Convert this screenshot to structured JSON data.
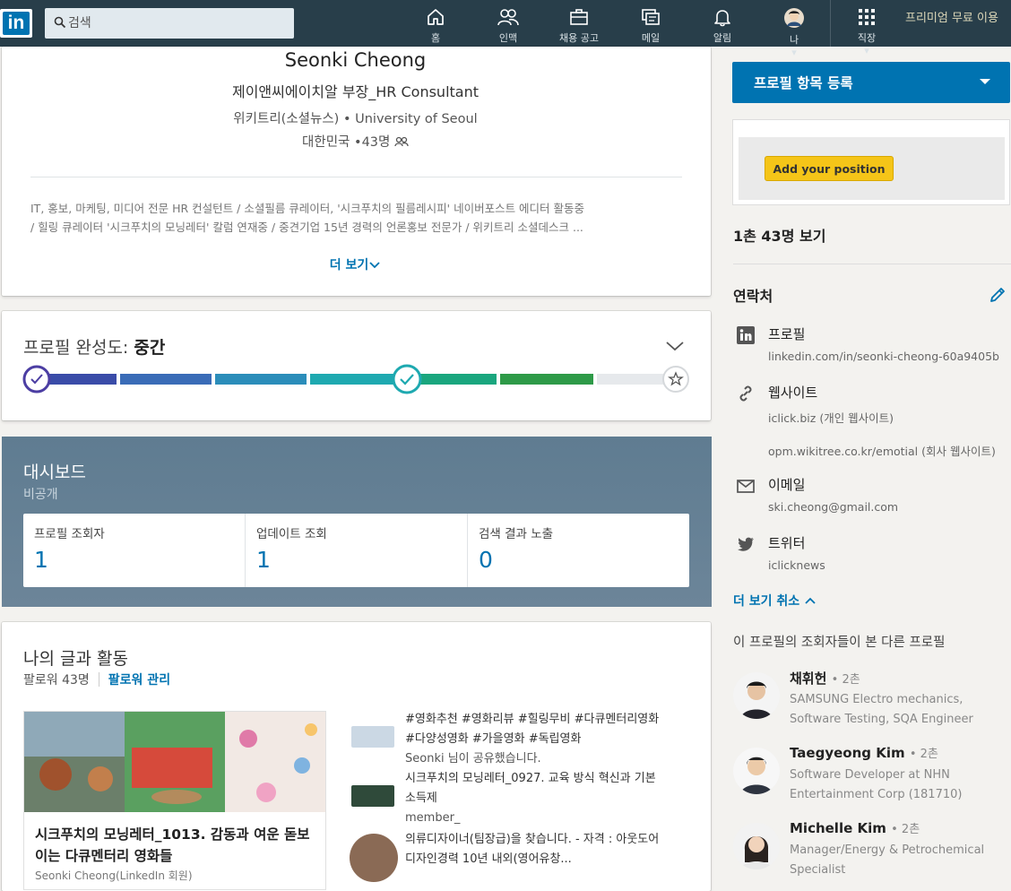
{
  "nav": {
    "logo": "in",
    "search_placeholder": "검색",
    "items": [
      {
        "label": "홈",
        "icon": "home-icon"
      },
      {
        "label": "인맥",
        "icon": "network-icon"
      },
      {
        "label": "채용 공고",
        "icon": "jobs-icon"
      },
      {
        "label": "메일",
        "icon": "messaging-icon"
      },
      {
        "label": "알림",
        "icon": "bell-icon"
      },
      {
        "label": "나",
        "icon": "avatar"
      },
      {
        "label": "직장",
        "icon": "grid-icon"
      }
    ],
    "premium": "프리미엄 무료 이용"
  },
  "profile": {
    "name": "Seonki Cheong",
    "headline": "제이앤씨에이치알 부장_HR Consultant",
    "company": "위키트리(소셜뉴스)",
    "school": "University of Seoul",
    "location": "대한민국",
    "connections": "43명",
    "summary_lines": [
      "IT, 홍보, 마케팅, 미디어 전문 HR 컨설턴트 / 소셜필름 큐레이터, '시크푸치의 필름레시피' 네이버포스트 에디터 활동중",
      "/ 힐링 큐레이터 '시크푸치의 모닝레터' 칼럼 연재중 / 중견기업 15년 경력의 언론홍보 전문가 / 위키트리 소셜데스크 ..."
    ],
    "more": "더 보기"
  },
  "strength": {
    "label": "프로필 완성도:",
    "level": "중간",
    "progress_percent": 55
  },
  "dashboard": {
    "title": "대시보드",
    "subtitle": "비공개",
    "stats": [
      {
        "label": "프로필 조회자",
        "value": "1"
      },
      {
        "label": "업데이트 조회",
        "value": "1"
      },
      {
        "label": "검색 결과 노출",
        "value": "0"
      }
    ]
  },
  "activity": {
    "title": "나의 글과 활동",
    "followers": "팔로워 43명",
    "manage": "팔로워 관리",
    "article": {
      "title": "시크푸치의 모닝레터_1013. 감동과 여운 돋보이는 다큐멘터리 영화들",
      "author": "Seonki Cheong(LinkedIn 회원)"
    },
    "feed": [
      {
        "text": "#영화추천 #영화리뷰 #힐링무비 #다큐멘터리영화 #다양성영화 #가을영화 #독립영화",
        "by": "Seonki 님이 공유했습니다."
      },
      {
        "text": "시크푸치의 모닝레터_0927. 교육 방식 혁신과 기본소득제",
        "by": "member_"
      },
      {
        "text": "의류디자이너(팀장급)을 찾습니다. - 자격 : 아웃도어 디자인경력 10년 내외(영어유창...",
        "by": ""
      }
    ]
  },
  "sidebar": {
    "cta": "프로필 항목 등록",
    "ad_button": "Add your position",
    "connections_link": "1촌 43명 보기",
    "contact_title": "연락처",
    "contacts": [
      {
        "label": "프로필",
        "icon": "linkedin-icon",
        "values": [
          "linkedin.com/in/seonki-cheong-60a9405b"
        ]
      },
      {
        "label": "웹사이트",
        "icon": "link-icon",
        "values": [
          "iclick.biz (개인 웹사이트)",
          "opm.wikitree.co.kr/emotial (회사 웹사이트)"
        ]
      },
      {
        "label": "이메일",
        "icon": "mail-icon",
        "values": [
          "ski.cheong@gmail.com"
        ]
      },
      {
        "label": "트위터",
        "icon": "twitter-icon",
        "values": [
          "iclicknews"
        ]
      }
    ],
    "less": "더 보기 취소",
    "also_viewed": "이 프로필의 조회자들이 본 다른 프로필",
    "people": [
      {
        "name": "채휘헌",
        "degree": "• 2촌",
        "desc": "SAMSUNG Electro mechanics, Software Testing, SQA Engineer"
      },
      {
        "name": "Taegyeong Kim",
        "degree": "• 2촌",
        "desc": "Software Developer at NHN Entertainment Corp (181710)"
      },
      {
        "name": "Michelle Kim",
        "degree": "• 2촌",
        "desc": "Manager/Energy & Petrochemical Specialist"
      }
    ]
  },
  "colors": {
    "nav": "#283e4a",
    "brand": "#0073b1",
    "cta": "#0073b1",
    "ad_button": "#f5c518"
  }
}
